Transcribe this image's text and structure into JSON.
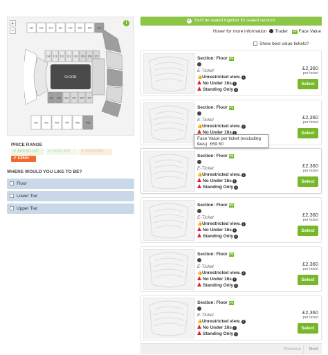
{
  "map": {
    "zoom_in": "+",
    "zoom_out": "−",
    "info": "i",
    "floor_label": "FLOOR",
    "upper_top_blocks": [
      "414",
      "413",
      "412",
      "411",
      "410",
      "409",
      "408",
      "407"
    ],
    "lower_top_blocks": [
      "114",
      "113",
      "112",
      "111",
      "110",
      "109",
      "108",
      "107"
    ],
    "lower_bottom_blocks": [
      "101",
      "102",
      "103",
      "104",
      "105",
      "106"
    ],
    "upper_bottom_blocks": [
      "401",
      "402",
      "403",
      "404",
      "405",
      "406"
    ],
    "right_blocks": [
      "418",
      "417",
      "416"
    ],
    "left_blocks": [
      "415",
      "416",
      "115",
      "116",
      "117"
    ],
    "mid_labels": [
      "115",
      "116",
      "117",
      "118"
    ],
    "colors": {
      "upper": "#ffffff",
      "lower": "#d9d9d9",
      "highlight": "#9e9e9e",
      "floor": "#4a4a4a"
    }
  },
  "price_range": {
    "title": "PRICE RANGE",
    "chips": [
      "£69.50-157",
      "£157-200",
      "£200-354",
      "£354+"
    ]
  },
  "where": {
    "title": "WHERE WOULD YOU LIKE TO BE?",
    "tiers": [
      "Floor",
      "Lower Tier",
      "Upper Tier"
    ]
  },
  "banner": "You'll be seated together for seated sections",
  "legend": {
    "hover": "Hover for more information",
    "trader": "Trader",
    "fv": "FV",
    "face_value": "Face Value"
  },
  "best_value": "Show best value tickets?",
  "tooltip": "Face Value per ticket (excluding fees): £69.50",
  "listings": [
    {
      "section": "Section: Floor",
      "type": "E-Ticket",
      "view": "Unrestricted view.",
      "age": "No Under 16s",
      "standing": "Standing Only",
      "price": "£2,360",
      "per": "per ticket",
      "button": "Select"
    },
    {
      "section": "Section: Floor",
      "type": "E-Ticket",
      "view": "Unrestricted view.",
      "age": "No Under 16s",
      "standing": "Standing Only",
      "price": "£2,360",
      "per": "per ticket",
      "button": "Select"
    },
    {
      "section": "Section: Floor",
      "type": "E-Ticket",
      "view": "Unrestricted view.",
      "age": "No Under 16s",
      "standing": "Standing Only",
      "price": "£2,360",
      "per": "per ticket",
      "button": "Select"
    },
    {
      "section": "Section: Floor",
      "type": "E-Ticket",
      "view": "Unrestricted view.",
      "age": "No Under 16s",
      "standing": "Standing Only",
      "price": "£2,360",
      "per": "per ticket",
      "button": "Select"
    },
    {
      "section": "Section: Floor",
      "type": "E-Ticket",
      "view": "Unrestricted view.",
      "age": "No Under 16s",
      "standing": "Standing Only",
      "price": "£2,360",
      "per": "per ticket",
      "button": "Select"
    },
    {
      "section": "Section: Floor",
      "type": "E-Ticket",
      "view": "Unrestricted view.",
      "age": "No Under 16s",
      "standing": "Standing Only",
      "price": "£2,360",
      "per": "per ticket",
      "button": "Select"
    }
  ],
  "pager": {
    "previous": "Previous",
    "next": "Next"
  }
}
